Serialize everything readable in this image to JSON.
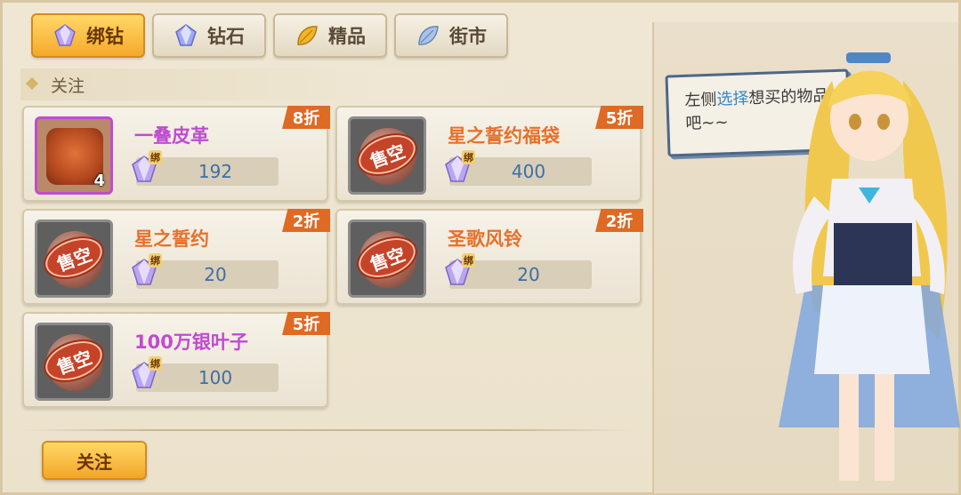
{
  "tabs": [
    {
      "label": "绑钻",
      "active": true,
      "icon": "bound-diamond-icon"
    },
    {
      "label": "钻石",
      "active": false,
      "icon": "diamond-icon"
    },
    {
      "label": "精品",
      "active": false,
      "icon": "gold-leaf-icon"
    },
    {
      "label": "街市",
      "active": false,
      "icon": "blue-leaf-icon"
    }
  ],
  "section": {
    "title": "关注"
  },
  "items": [
    {
      "name": "一叠皮革",
      "discount": "8折",
      "price": "192",
      "count": "4",
      "sold_out": false,
      "rarity": "purple"
    },
    {
      "name": "星之誓约福袋",
      "discount": "5折",
      "price": "400",
      "sold_out": true,
      "stamp": "售空"
    },
    {
      "name": "星之誓约",
      "discount": "2折",
      "price": "20",
      "sold_out": true,
      "stamp": "售空"
    },
    {
      "name": "圣歌风铃",
      "discount": "2折",
      "price": "20",
      "sold_out": true,
      "stamp": "售空"
    },
    {
      "name": "100万银叶子",
      "discount": "5折",
      "price": "100",
      "sold_out": true,
      "stamp": "售空",
      "rarity": "purple"
    }
  ],
  "bind_label": "绑",
  "footer": {
    "follow_button": "关注"
  },
  "npc": {
    "speech_before": "左侧",
    "speech_highlight": "选择",
    "speech_after": "想买的物品吧~~"
  },
  "colors": {
    "accent_orange": "#de6a24",
    "tab_active": "#f5a92a",
    "price_blue": "#3d6fa8",
    "highlight_blue": "#3a86c8"
  }
}
